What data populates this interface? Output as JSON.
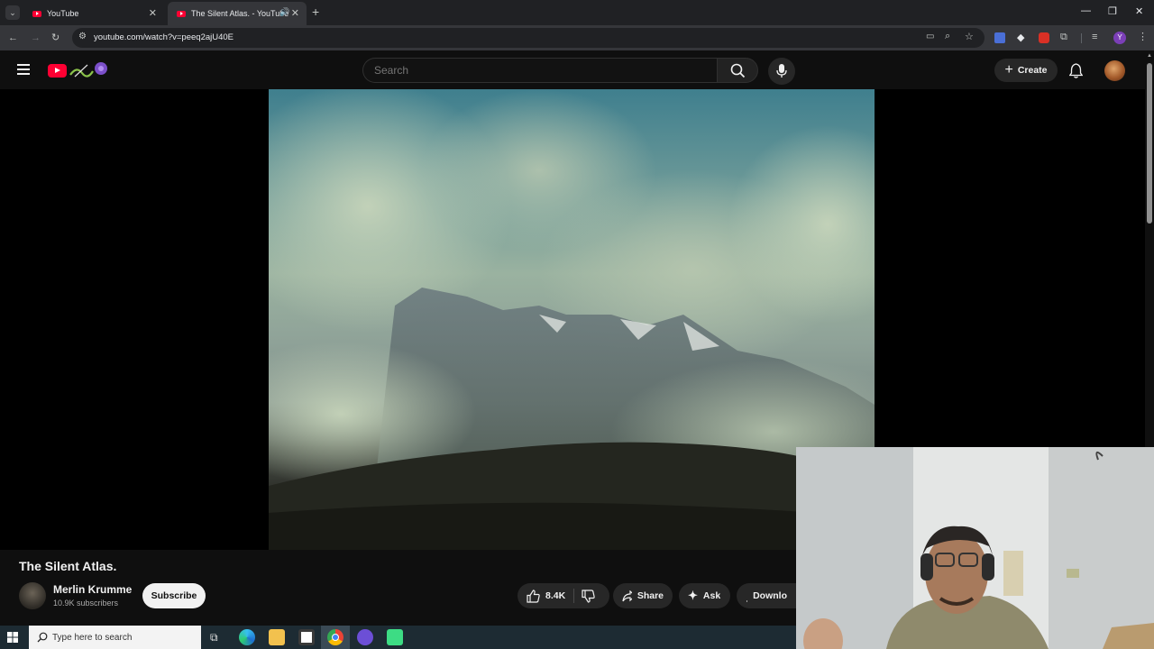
{
  "browser": {
    "tabs": [
      {
        "title": "YouTube",
        "active": false
      },
      {
        "title": "The Silent Atlas. - YouTube",
        "active": true
      }
    ],
    "url": "youtube.com/watch?v=peeq2ajU40E",
    "profile_initial": "Y"
  },
  "youtube": {
    "search_placeholder": "Search",
    "create_label": "Create"
  },
  "video": {
    "title": "The Silent Atlas.",
    "channel_name": "Merlin Krumme",
    "subscribers": "10.9K subscribers",
    "subscribe_label": "Subscribe",
    "likes": "8.4K",
    "share_label": "Share",
    "ask_label": "Ask",
    "download_label": "Downlo"
  },
  "taskbar": {
    "search_placeholder": "Type here to search"
  },
  "colors": {
    "youtube_red": "#ff0033",
    "page_bg": "#0f0f0f",
    "chrome_bg": "#202124"
  }
}
